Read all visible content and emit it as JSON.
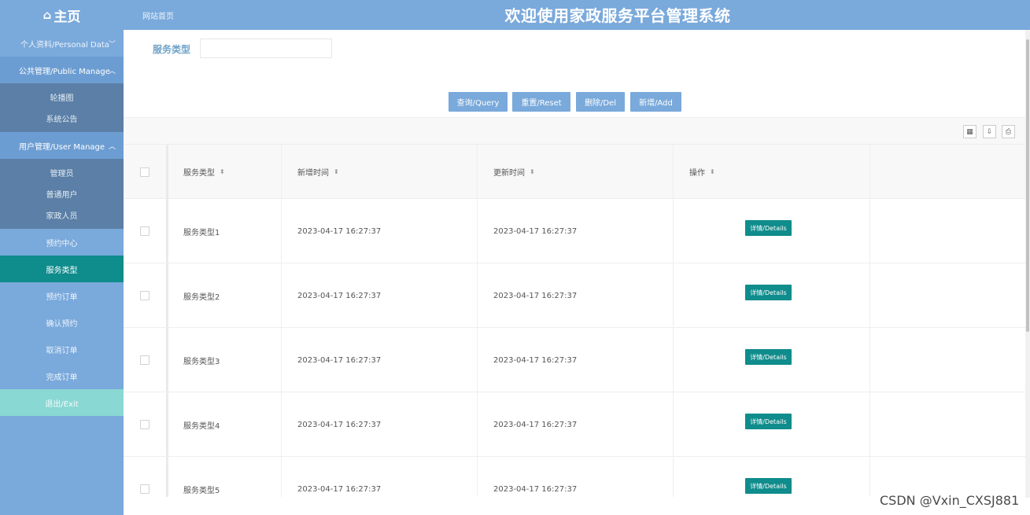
{
  "header": {
    "home_icon": "home-icon",
    "home_label": "主页",
    "site_link": "网站首页",
    "system_title": "欢迎使用家政服务平台管理系统"
  },
  "sidebar": {
    "personal": "个人资料/Personal Data",
    "public_group": "公共管理/Public Manage",
    "public_items": [
      "轮播图",
      "系统公告"
    ],
    "user_group": "用户管理/User Manage",
    "user_items": [
      "管理员",
      "普通用户",
      "家政人员"
    ],
    "items": [
      "预约中心",
      "服务类型",
      "预约订单",
      "确认预约",
      "取消订单",
      "完成订单"
    ],
    "exit": "退出/Exit",
    "active": "服务类型"
  },
  "search": {
    "label": "服务类型",
    "value": ""
  },
  "buttons": {
    "query": "查询/Query",
    "reset": "重置/Reset",
    "delete": "删除/Del",
    "add": "新增/Add"
  },
  "toolbar_icons": [
    "columns-icon",
    "export-icon",
    "print-icon"
  ],
  "table": {
    "columns": [
      "服务类型",
      "新增时间",
      "更新时间",
      "操作"
    ],
    "rows": [
      {
        "type": "服务类型1",
        "created": "2023-04-17 16:27:37",
        "updated": "2023-04-17 16:27:37",
        "action": "详情/Details"
      },
      {
        "type": "服务类型2",
        "created": "2023-04-17 16:27:37",
        "updated": "2023-04-17 16:27:37",
        "action": "详情/Details"
      },
      {
        "type": "服务类型3",
        "created": "2023-04-17 16:27:37",
        "updated": "2023-04-17 16:27:37",
        "action": "详情/Details"
      },
      {
        "type": "服务类型4",
        "created": "2023-04-17 16:27:37",
        "updated": "2023-04-17 16:27:37",
        "action": "详情/Details"
      },
      {
        "type": "服务类型5",
        "created": "2023-04-17 16:27:37",
        "updated": "2023-04-17 16:27:37",
        "action": "详情/Details"
      }
    ]
  },
  "watermark": "CSDN @Vxin_CXSJ881",
  "colors": {
    "brand": "#7aa9db",
    "active": "#0f8c8c",
    "exit": "#8ad8d3",
    "submenu": "#5b7fa6"
  }
}
